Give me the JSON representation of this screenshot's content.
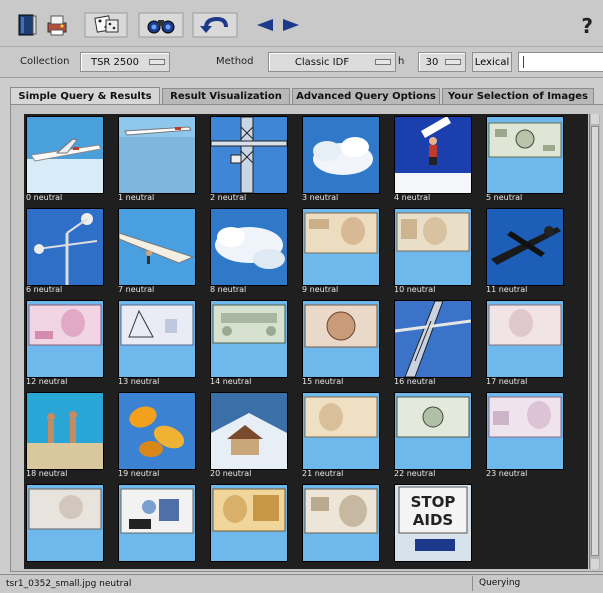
{
  "toolbar": {
    "help_label": "?"
  },
  "collection": {
    "label": "Collection",
    "value": "TSR   2500",
    "method_label": "Method",
    "method_value": "Classic IDF",
    "method_suffix": "h",
    "count_value": "30",
    "lexical_label": "Lexical"
  },
  "tabs": [
    {
      "label": "Simple Query & Results",
      "active": true
    },
    {
      "label": "Result Visualization",
      "active": false
    },
    {
      "label": "Advanced Query Options",
      "active": false
    },
    {
      "label": "Your Selection of Images",
      "active": false
    }
  ],
  "results": [
    {
      "caption": "0   neutral"
    },
    {
      "caption": "1   neutral"
    },
    {
      "caption": "2   neutral"
    },
    {
      "caption": "3   neutral"
    },
    {
      "caption": "4   neutral"
    },
    {
      "caption": "5   neutral"
    },
    {
      "caption": "6   neutral"
    },
    {
      "caption": "7   neutral"
    },
    {
      "caption": "8   neutral"
    },
    {
      "caption": "9   neutral"
    },
    {
      "caption": "10   neutral"
    },
    {
      "caption": "11   neutral"
    },
    {
      "caption": "12   neutral"
    },
    {
      "caption": "13   neutral"
    },
    {
      "caption": "14   neutral"
    },
    {
      "caption": "15   neutral"
    },
    {
      "caption": "16   neutral"
    },
    {
      "caption": "17   neutral"
    },
    {
      "caption": "18   neutral"
    },
    {
      "caption": "19   neutral"
    },
    {
      "caption": "20   neutral"
    },
    {
      "caption": "21   neutral"
    },
    {
      "caption": "22   neutral"
    },
    {
      "caption": "23   neutral"
    },
    {
      "caption": ""
    },
    {
      "caption": ""
    },
    {
      "caption": ""
    },
    {
      "caption": ""
    },
    {
      "caption": ""
    }
  ],
  "status": {
    "left": "tsr1_0352_small.jpg   neutral",
    "right": "Querying"
  },
  "thumb_text": {
    "stop": "STOP",
    "aids": "AIDS"
  },
  "colors": {
    "accent": "#6fb8ec",
    "grid_bg": "#1f1f1f"
  }
}
